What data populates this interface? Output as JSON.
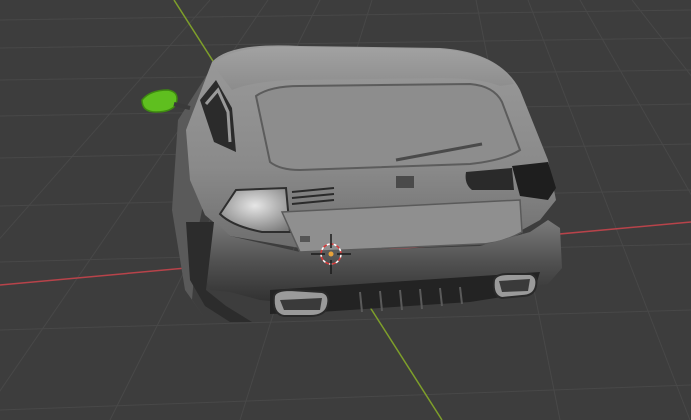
{
  "viewport": {
    "background": "#3d3d3d",
    "grid_color": "#4a4a4a",
    "x_axis_color": "#b8434a",
    "y_axis_color": "#7e9f2a"
  },
  "object": {
    "body_color": "#8c8c8c",
    "trim_color": "#1f1f1f",
    "selected_part_color": "#5fbf1f"
  },
  "icons": {
    "cursor": "3d-cursor-icon"
  }
}
